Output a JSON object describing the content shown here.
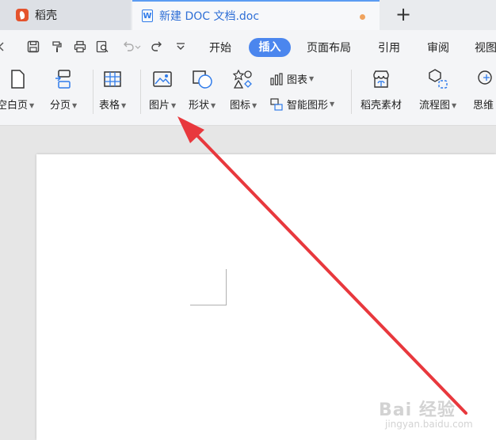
{
  "tabs": {
    "app_tab_label": "稻壳",
    "doc_tab_label": "新建 DOC 文档.doc",
    "doc_icon_letter": "W",
    "new_tab_symbol": "+"
  },
  "menu": {
    "items": [
      "开始",
      "插入",
      "页面布局",
      "引用",
      "审阅",
      "视图"
    ],
    "active_item": "插入"
  },
  "ribbon": {
    "blank_page": "空白页",
    "page_break": "分页",
    "table": "表格",
    "picture": "图片",
    "shape": "形状",
    "icon": "图标",
    "chart": "图表",
    "smart_graphic": "智能图形",
    "material": "稻壳素材",
    "flowchart": "流程图",
    "mindmap": "思维"
  },
  "watermark": {
    "brand": "Bai 经验",
    "url": "jingyan.baidu.com"
  },
  "colors": {
    "accent": "#4b86ee",
    "arrow": "#e8383d",
    "app_logo": "#e4532d"
  }
}
